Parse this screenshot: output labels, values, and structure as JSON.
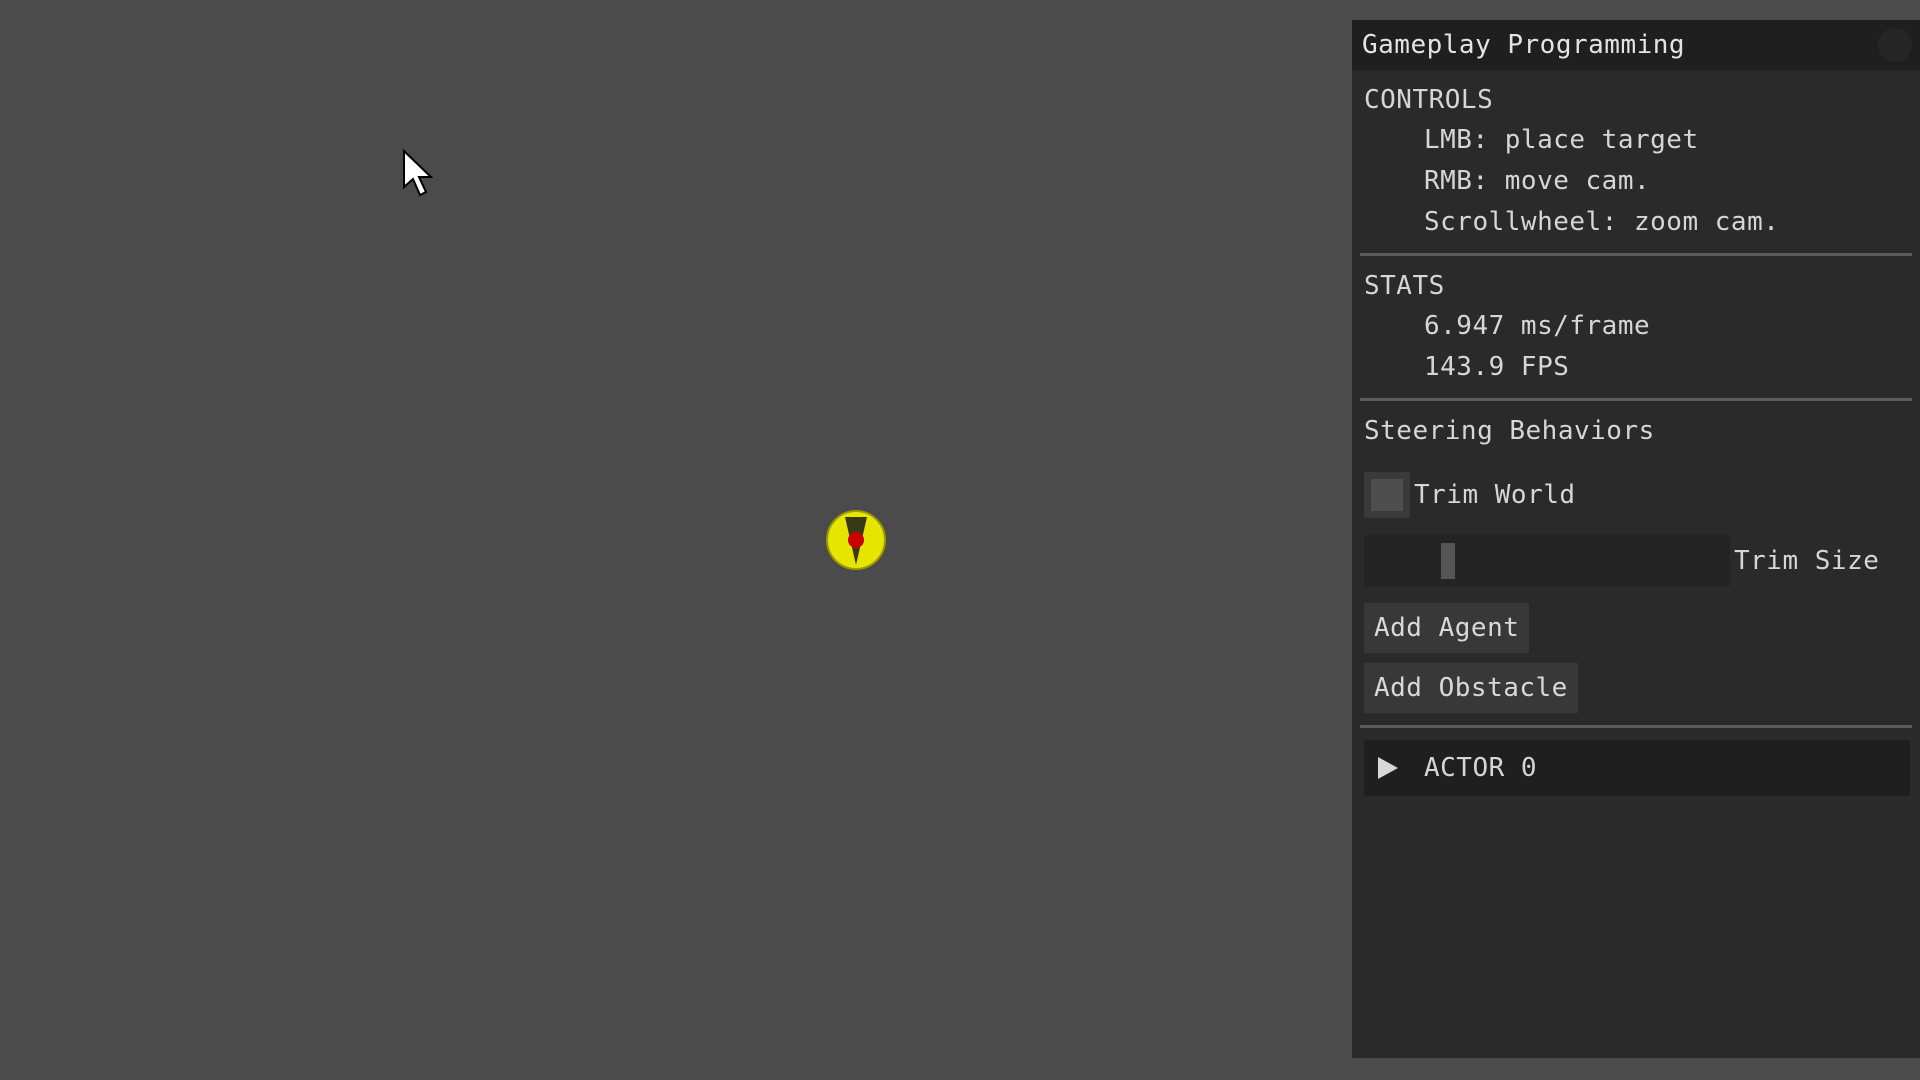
{
  "window": {
    "title": "Gameplay Programming"
  },
  "controls": {
    "heading": "CONTROLS",
    "lines": [
      "LMB: place target",
      "RMB: move cam.",
      "Scrollwheel: zoom cam."
    ]
  },
  "stats": {
    "heading": "STATS",
    "frame_time": "6.947 ms/frame",
    "fps": "143.9 FPS"
  },
  "steering": {
    "heading": "Steering Behaviors",
    "trim_world": {
      "label": "Trim World",
      "checked": false
    },
    "trim_size": {
      "label": "Trim Size",
      "value_fraction": 0.22
    },
    "add_agent_label": "Add Agent",
    "add_obstacle_label": "Add Obstacle"
  },
  "actors": {
    "items": [
      {
        "label": "ACTOR 0",
        "expanded": false
      }
    ]
  },
  "scene": {
    "background_color": "#4b4b4b",
    "agent_color": "#e5e500",
    "agent_center_color": "#cc0000",
    "target_color": "#1f5a1f"
  }
}
